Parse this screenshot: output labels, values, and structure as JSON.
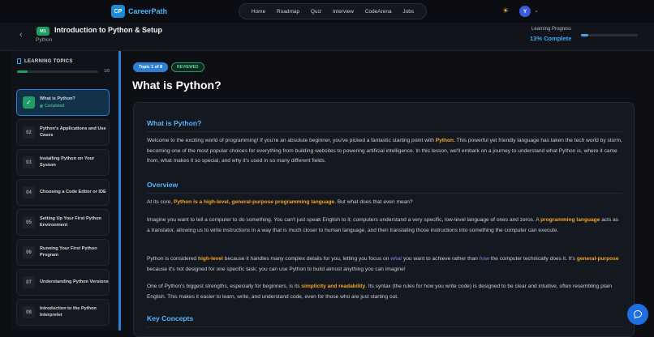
{
  "nav": {
    "logo_badge": "CP",
    "logo_text": "CareerPath",
    "links": [
      "Home",
      "Roadmap",
      "Quiz",
      "Interview",
      "CodeArena",
      "Jobs"
    ],
    "avatar_initial": "Y"
  },
  "header": {
    "module_badge": "M1",
    "title": "Introduction to Python & Setup",
    "subtitle": "Python",
    "progress_label": "Learning Progress",
    "progress_value": "13% Complete",
    "progress_fraction": 0.13
  },
  "sidebar": {
    "title": "LEARNING TOPICS",
    "count": "1/8",
    "progress_fraction": 0.125,
    "topics": [
      {
        "num": "01",
        "label": "What is Python?",
        "status": "Completed",
        "active": true
      },
      {
        "num": "02",
        "label": "Python's Applications and Use Cases"
      },
      {
        "num": "03",
        "label": "Installing Python on Your System"
      },
      {
        "num": "04",
        "label": "Choosing a Code Editor or IDE"
      },
      {
        "num": "05",
        "label": "Setting Up Your First Python Environment"
      },
      {
        "num": "06",
        "label": "Running Your First Python Program"
      },
      {
        "num": "07",
        "label": "Understanding Python Versions"
      },
      {
        "num": "08",
        "label": "Introduction to the Python Interpreter"
      }
    ]
  },
  "main": {
    "topic_badge": "Topic 1 of 8",
    "reviewed_badge": "REVIEWED",
    "page_title": "What is Python?",
    "sections": {
      "h_what": "What is Python?",
      "p_intro_1": "Welcome to the exciting world of programming! If you're an absolute beginner, you've picked a fantastic starting point with ",
      "p_intro_hl": "Python",
      "p_intro_2": ". This powerful yet friendly language has taken the tech world by storm, becoming one of the most popular choices for everything from building websites to powering artificial intelligence. In this lesson, we'll embark on a journey to understand what Python is, where it came from, what makes it so special, and why it's used in so many different fields.",
      "h_overview": "Overview",
      "p_core_1": "At its core, ",
      "p_core_hl": "Python is a high-level, general-purpose programming language",
      "p_core_2": ". But what does that even mean?",
      "p_imagine_1": "Imagine you want to tell a computer to do something. You can't just speak English to it; computers understand a very specific, low-level language of ones and zeros. A ",
      "p_imagine_hl": "programming language",
      "p_imagine_2": " acts as a translator, allowing us to write instructions in a way that is much closer to human language, and then translating those instructions into something the computer can execute.",
      "p_hl_1": "Python is considered ",
      "p_hl_hl1": "high-level",
      "p_hl_2": " because it handles many complex details for you, letting you focus on ",
      "p_hl_it1": "what",
      "p_hl_3": " you want to achieve rather than ",
      "p_hl_it2": "how",
      "p_hl_4": " the computer technically does it. It's ",
      "p_hl_hl2": "general-purpose",
      "p_hl_5": " because it's not designed for one specific task; you can use Python to build almost anything you can imagine!",
      "p_str_1": "One of Python's biggest strengths, especially for beginners, is its ",
      "p_str_hl": "simplicity and readability",
      "p_str_2": ". Its syntax (the rules for how you write code) is designed to be clear and intuitive, often resembling plain English. This makes it easier to learn, write, and understand code, even for those who are just starting out.",
      "h_key": "Key Concepts"
    }
  },
  "colors": {
    "accent": "#3ea8f5",
    "highlight": "#f5a524",
    "success": "#1f9d64",
    "background": "#0d0f14"
  }
}
